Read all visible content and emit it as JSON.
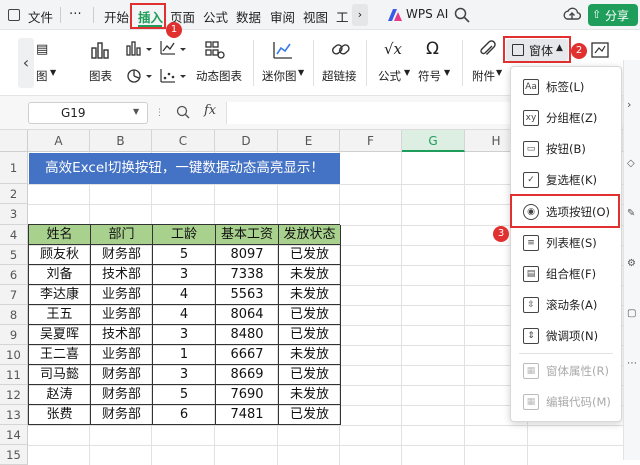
{
  "menubar": {
    "file": "文件",
    "more": "⋯",
    "tabs": [
      "开始",
      "插入",
      "页面",
      "公式",
      "数据",
      "审阅",
      "视图",
      "工"
    ],
    "wps_ai": "WPS AI",
    "share": "分享"
  },
  "ribbon": {
    "truncated_group": "图",
    "chart": "图表",
    "dynamic_chart": "动态图表",
    "sparkline": "迷你图",
    "hyperlink": "超链接",
    "formula": "公式",
    "symbol": "符号",
    "attachment": "附件",
    "form_control": "窗体"
  },
  "formula_bar": {
    "cell_ref": "G19",
    "fx": "fx"
  },
  "sheet": {
    "columns": [
      "A",
      "B",
      "C",
      "D",
      "E",
      "F",
      "G",
      "H"
    ],
    "rows": [
      "1",
      "2",
      "3",
      "4",
      "5",
      "6",
      "7",
      "8",
      "9",
      "10",
      "11",
      "12",
      "13",
      "14",
      "15"
    ],
    "banner": "高效Excel切换按钮，一键数据动态高亮显示！",
    "headers": [
      "姓名",
      "部门",
      "工龄",
      "基本工资",
      "发放状态"
    ],
    "data": [
      [
        "顾友秋",
        "财务部",
        "5",
        "8097",
        "已发放"
      ],
      [
        "刘备",
        "技术部",
        "3",
        "7338",
        "未发放"
      ],
      [
        "李达康",
        "业务部",
        "4",
        "5563",
        "未发放"
      ],
      [
        "王五",
        "业务部",
        "4",
        "8064",
        "已发放"
      ],
      [
        "吴夏晖",
        "技术部",
        "3",
        "8480",
        "已发放"
      ],
      [
        "王二喜",
        "业务部",
        "1",
        "6667",
        "未发放"
      ],
      [
        "司马懿",
        "财务部",
        "3",
        "8669",
        "已发放"
      ],
      [
        "赵涛",
        "财务部",
        "5",
        "7690",
        "未发放"
      ],
      [
        "张费",
        "财务部",
        "6",
        "7481",
        "已发放"
      ]
    ]
  },
  "dropdown": {
    "items": [
      {
        "label": "标签(L)",
        "icon": "Aa"
      },
      {
        "label": "分组框(Z)",
        "icon": "xy"
      },
      {
        "label": "按钮(B)",
        "icon": "▭"
      },
      {
        "label": "复选框(K)",
        "icon": "✓"
      },
      {
        "label": "选项按钮(O)",
        "icon": "◉"
      },
      {
        "label": "列表框(S)",
        "icon": "≡"
      },
      {
        "label": "组合框(F)",
        "icon": "▤"
      },
      {
        "label": "滚动条(A)",
        "icon": "⇳"
      },
      {
        "label": "微调项(N)",
        "icon": "⇕"
      },
      {
        "label": "窗体属性(R)",
        "icon": "▦"
      },
      {
        "label": "编辑代码(M)",
        "icon": "▦"
      }
    ]
  },
  "badges": [
    "1",
    "2",
    "3"
  ],
  "colors": {
    "accent_green": "#1e9e5a",
    "banner_blue": "#4472c4",
    "header_green": "#a9d18e",
    "callout_red": "#e0302f"
  }
}
